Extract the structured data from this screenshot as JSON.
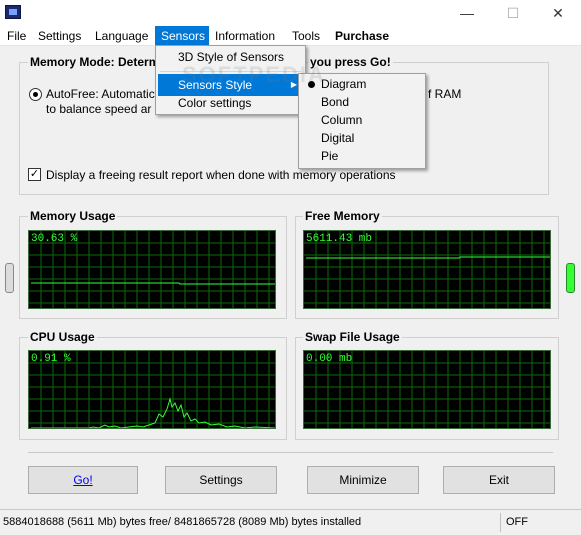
{
  "window": {
    "minimize_glyph": "—",
    "maximize_glyph": "☐",
    "close_glyph": "✕"
  },
  "menu": {
    "items": [
      "File",
      "Settings",
      "Language",
      "Sensors",
      "Information",
      "Tools",
      "Purchase"
    ],
    "active": "Sensors"
  },
  "sensors_menu": {
    "items": [
      "3D Style of Sensors",
      "Sensors Style",
      "Color settings"
    ],
    "highlighted": "Sensors Style"
  },
  "sensors_style_menu": {
    "items": [
      "Diagram",
      "Bond",
      "Column",
      "Digital",
      "Pie"
    ],
    "selected": "Diagram"
  },
  "memory_mode": {
    "title_left": "Memory Mode: Determ",
    "title_right": "you press Go!",
    "autofree_line1": "AutoFree: Automatic",
    "autofree_line2": "to balance speed ar",
    "autofree_tail": "f RAM",
    "report_checkbox_label": "Display a freeing result report when done with memory operations",
    "report_checked": true
  },
  "panels": {
    "memory_usage": {
      "title": "Memory Usage",
      "value": "30.63 %"
    },
    "free_memory": {
      "title": "Free Memory",
      "value": "5611.43 mb"
    },
    "cpu_usage": {
      "title": "CPU Usage",
      "value": "0.91 %"
    },
    "swap_file": {
      "title": "Swap File Usage",
      "value": "0.00 mb"
    }
  },
  "buttons": {
    "go": "Go!",
    "settings": "Settings",
    "minimize": "Minimize",
    "exit": "Exit"
  },
  "status": {
    "bytes_text": "5884018688 (5611 Mb) bytes free/ 8481865728 (8089 Mb) bytes installed",
    "state": "OFF"
  },
  "colors": {
    "accent": "#0078d7",
    "graph_line": "#33ff33",
    "grid": "#0b6b0b"
  },
  "watermark": "SOFTPEDIA"
}
